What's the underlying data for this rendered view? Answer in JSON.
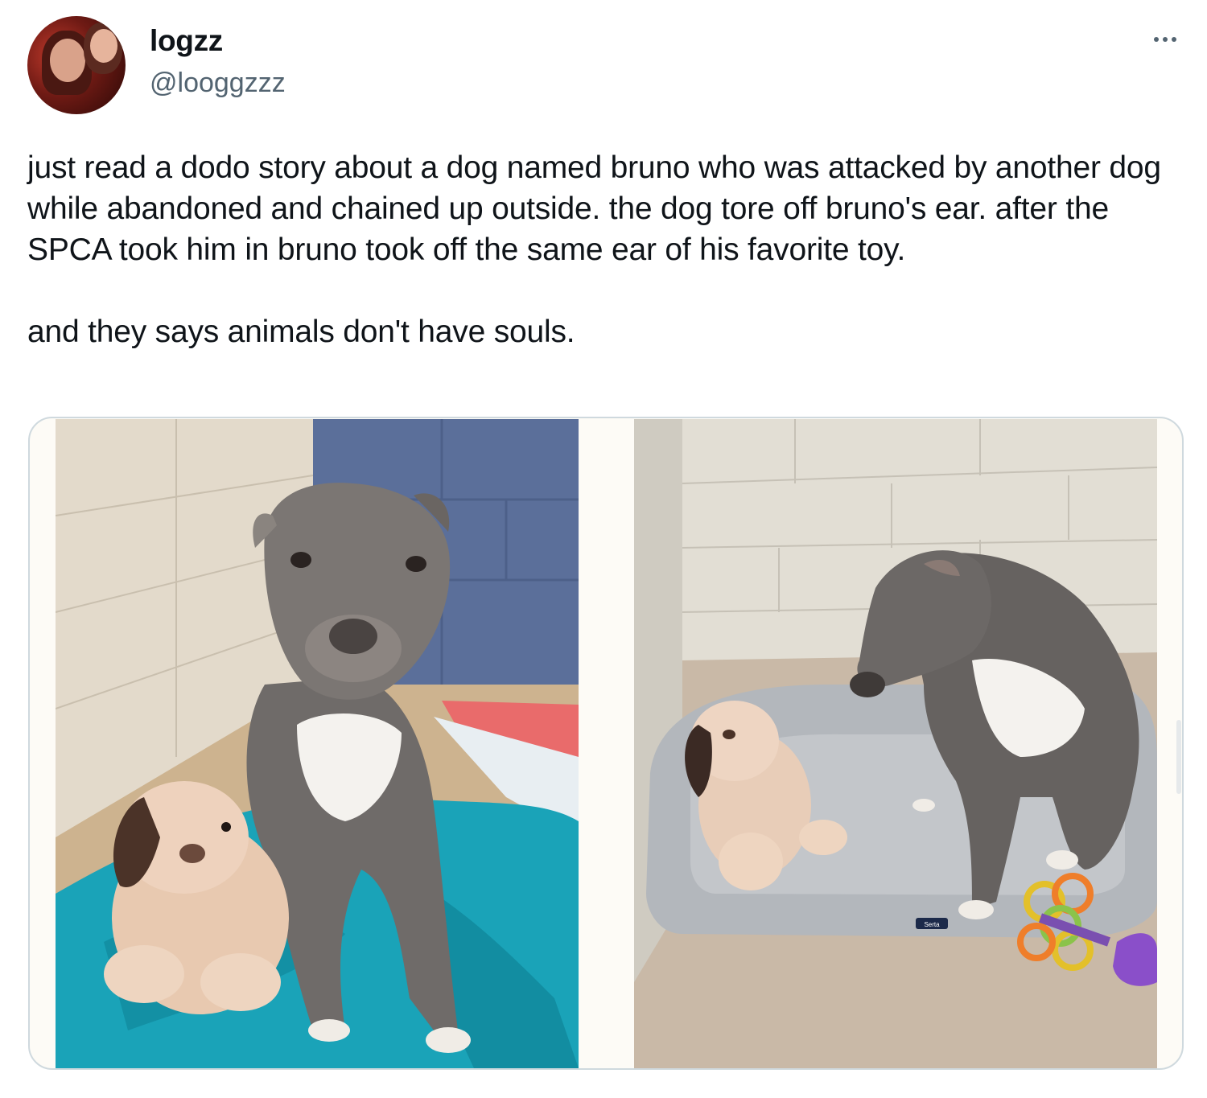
{
  "user": {
    "name": "logzz",
    "handle": "@looggzzz"
  },
  "menu": {
    "icon": "more-horizontal-icon"
  },
  "tweet": {
    "paragraphs": [
      "just read a dodo story about a dog named bruno who was attacked by another dog while abandoned and chained up outside. the dog tore off bruno's ear. after the SPCA took him in bruno took off the same ear of his favorite toy.",
      "and they says animals don't have souls."
    ]
  },
  "media": {
    "images": [
      {
        "name": "dog-with-plush-toy-photo"
      },
      {
        "name": "dog-on-bed-photo"
      }
    ],
    "bed_label": "Serta"
  },
  "colors": {
    "text": "#0f1419",
    "secondary_text": "#536471",
    "card_border": "#cfd9de",
    "blanket": "#1aa3b8",
    "dog_gray": "#6f6b69"
  }
}
